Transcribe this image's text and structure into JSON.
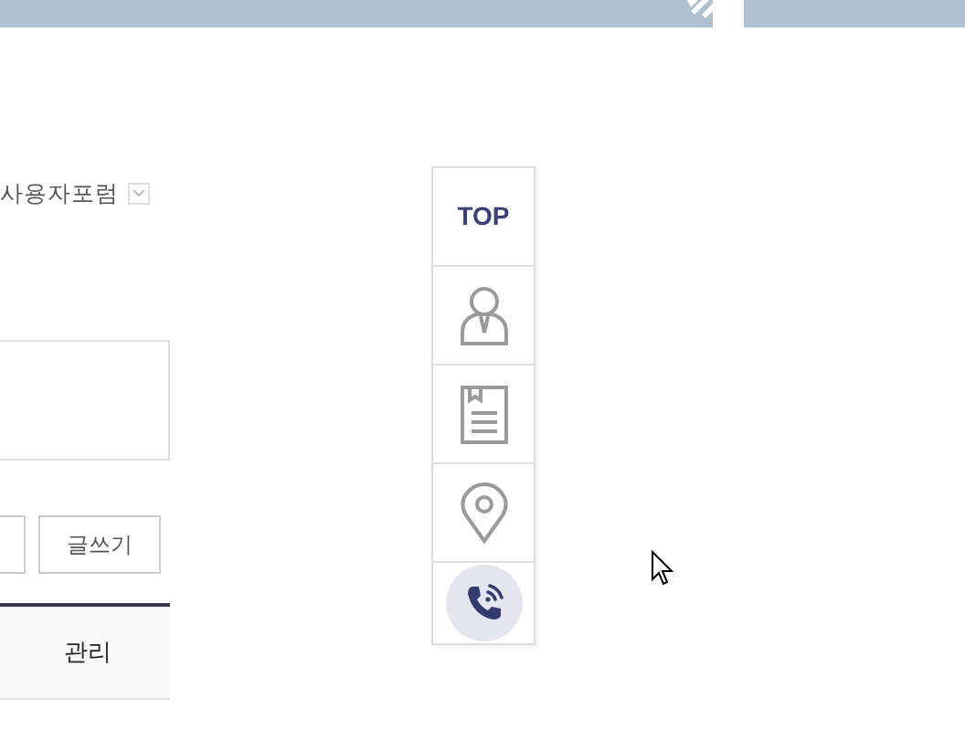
{
  "forum_menu": {
    "label": "사용자포럼"
  },
  "buttons": [
    {
      "label": "글쓰기"
    }
  ],
  "table": {
    "columns": [
      "관리"
    ]
  },
  "quick_menu": [
    {
      "kind": "text",
      "label": "TOP"
    },
    {
      "kind": "person"
    },
    {
      "kind": "document"
    },
    {
      "kind": "location"
    },
    {
      "kind": "phone"
    }
  ]
}
